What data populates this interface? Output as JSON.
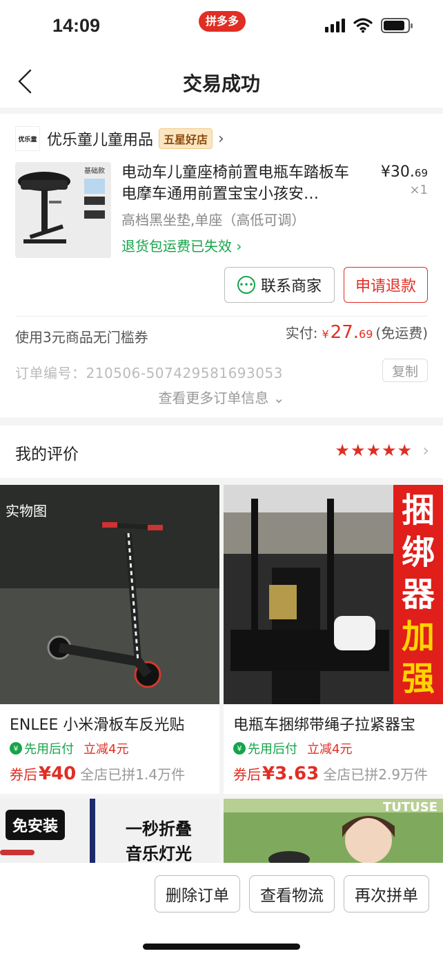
{
  "status_bar": {
    "time": "14:09",
    "app_badge": "拼多多"
  },
  "nav": {
    "title": "交易成功"
  },
  "shop": {
    "logo_text": "优乐童",
    "name": "优乐童儿童用品",
    "badge": "五星好店"
  },
  "product": {
    "title": "电动车儿童座椅前置电瓶车踏板车电摩车通用前置宝宝小孩安…",
    "price_int": "¥30.",
    "price_dec": "69",
    "quantity": "×1",
    "sku": "高档黑坐垫,单座（高低可调）",
    "return_note": "退货包运费已失效",
    "thumb_label": "基础款"
  },
  "actions": {
    "contact": "联系商家",
    "refund": "申请退款"
  },
  "summary": {
    "coupon": "使用3元商品无门槛券",
    "paid_label": "实付:",
    "paid_currency": "¥",
    "paid_int": "27.",
    "paid_dec": "69",
    "shipping": "(免运费)",
    "order_no": "订单编号：210506-507429581693053",
    "copy": "复制",
    "more": "查看更多订单信息"
  },
  "review": {
    "title": "我的评价",
    "stars": "★★★★★",
    "rating": 5
  },
  "recommendations": [
    {
      "name": "ENLEE 小米滑板车反光贴",
      "tag_pay": "先用后付",
      "tag_discount": "立减4元",
      "price_label": "券后",
      "price": "¥40",
      "sold": "全店已拼1.4万件",
      "image_tag": "实物图"
    },
    {
      "name": "电瓶车捆绑带绳子拉紧器宝",
      "tag_pay": "先用后付",
      "tag_discount": "立减4元",
      "price_label": "券后",
      "price": "¥3.63",
      "sold": "全店已拼2.9万件",
      "banner": [
        "捆",
        "绑",
        "器",
        "加",
        "强"
      ]
    },
    {
      "image_text_1": "免安装",
      "image_text_2": "一秒折叠",
      "image_text_3": "音乐灯光"
    },
    {
      "image_text_1": "TUTUSE"
    }
  ],
  "bottom": {
    "delete": "删除订单",
    "logistics": "查看物流",
    "reorder": "再次拼单"
  },
  "colors": {
    "accent": "#e02e24",
    "green": "#16a34a",
    "badge_bg": "#fbe6c2"
  }
}
